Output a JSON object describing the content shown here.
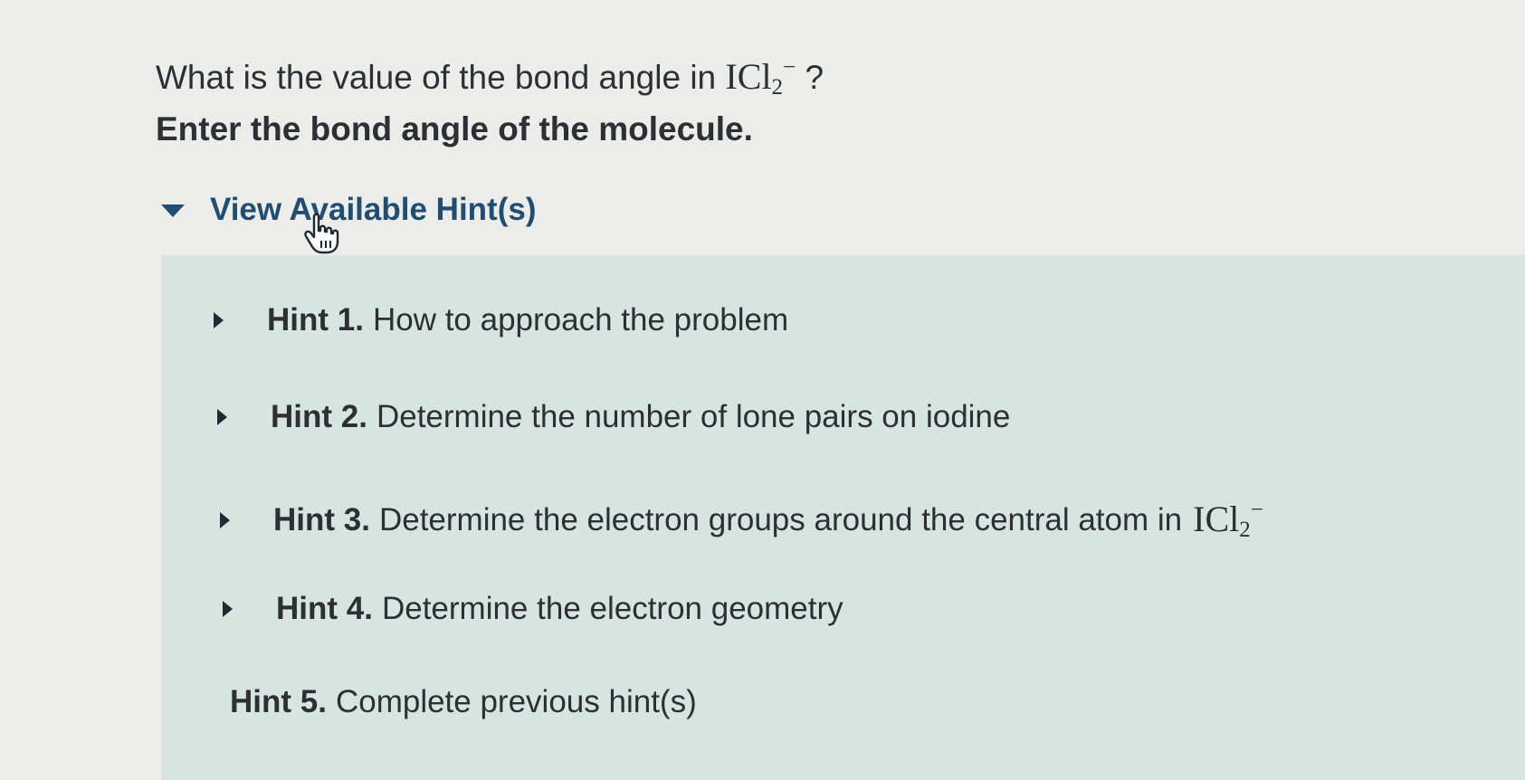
{
  "question": {
    "prefix": "What is the value of the bond angle in",
    "formula_base": "ICl",
    "formula_sub": "2",
    "formula_sup": "−",
    "suffix": "?"
  },
  "instruction": "Enter the bond angle of the molecule.",
  "hints": {
    "toggle_label": "View Available Hint(s)",
    "items": [
      {
        "number": "Hint 1.",
        "title": "How to approach the problem"
      },
      {
        "number": "Hint 2.",
        "title": "Determine the number of lone pairs on iodine"
      },
      {
        "number": "Hint 3.",
        "title": "Determine the electron groups around the central atom in"
      },
      {
        "number": "Hint 4.",
        "title": "Determine the electron geometry"
      },
      {
        "number": "Hint 5.",
        "title": "Complete previous hint(s)"
      }
    ],
    "hint3_formula": {
      "base": "ICl",
      "sub": "2",
      "sup": "−"
    }
  },
  "colors": {
    "background": "#ececea",
    "hint_panel": "#d7e5e1",
    "toggle_text": "#1f4e72",
    "body_text": "#2c2f33"
  },
  "icons": {
    "toggle": "caret-down-icon",
    "hint_expand": "caret-right-icon",
    "cursor": "hand-pointer-icon"
  }
}
